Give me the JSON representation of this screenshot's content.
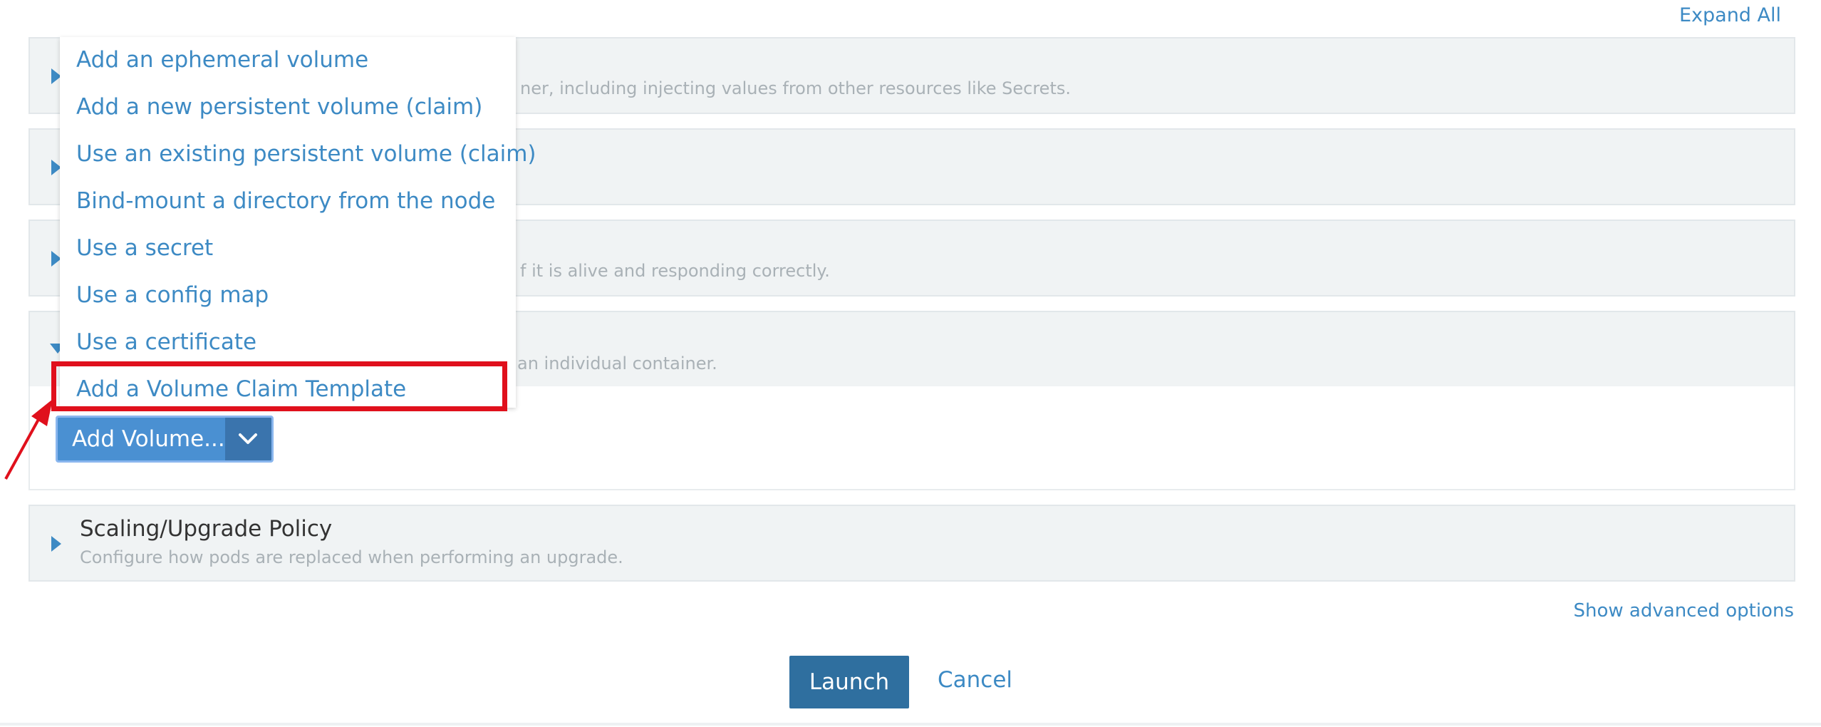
{
  "header": {
    "expand_all": "Expand All"
  },
  "sections": [
    {
      "desc_fragment": "ner, including injecting values from other resources like Secrets."
    },
    {
      "desc_fragment": ""
    },
    {
      "desc_fragment": "f it is alive and responding correctly."
    },
    {
      "desc_fragment": "an individual container."
    },
    {
      "title": "Scaling/Upgrade Policy",
      "desc": "Configure how pods are replaced when performing an upgrade."
    }
  ],
  "volume_menu": {
    "items": [
      "Add an ephemeral volume",
      "Add a new persistent volume (claim)",
      "Use an existing persistent volume (claim)",
      "Bind-mount a directory from the node",
      "Use a secret",
      "Use a config map",
      "Use a certificate",
      "Add a Volume Claim Template"
    ],
    "button_label": "Add Volume...",
    "highlighted_item": "Add a Volume Claim Template"
  },
  "footer": {
    "show_advanced": "Show advanced options",
    "launch": "Launch",
    "cancel": "Cancel"
  },
  "colors": {
    "link": "#3d8ac4",
    "primary_button": "#2f6f9f",
    "highlight": "#e0101c"
  },
  "icons": [
    "chevron-down-icon",
    "caret-right-icon",
    "caret-down-icon",
    "annotation-arrow-icon"
  ]
}
